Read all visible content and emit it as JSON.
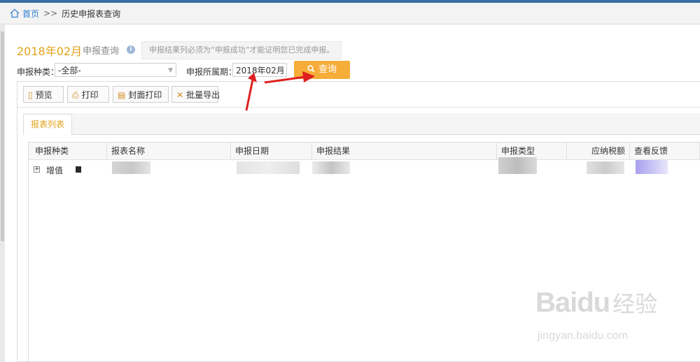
{
  "breadcrumb": {
    "home": "首页",
    "separator": ">>",
    "current": "历史申报表查询"
  },
  "header": {
    "period": "2018年02月",
    "title": "申报查询",
    "hint": "申报结果列必须为“申报成功”才能证明您已完成申报。"
  },
  "filters": {
    "type_label": "申报种类：",
    "type_value": "-全部-",
    "period_label": "申报所属期：",
    "period_value": "2018年02月",
    "query_button": "查询"
  },
  "toolbar": {
    "preview": "预览",
    "print": "打印",
    "cover_print": "封面打印",
    "batch_export": "批量导出"
  },
  "tabs": [
    "报表列表"
  ],
  "table": {
    "columns": [
      "申报种类",
      "报表名称",
      "申报日期",
      "申报结果",
      "申报类型",
      "应纳税额",
      "查看反馈"
    ],
    "rows": [
      {
        "type": "增值"
      }
    ]
  },
  "watermark": {
    "brand": "Baidu",
    "brand_cn": "经验",
    "url": "jingyan.baidu.com"
  },
  "colors": {
    "accent": "#e3a21a",
    "query_button": "#f6ad3a",
    "annotation_arrow": "#e02020",
    "link": "#2f7fcf"
  },
  "icons": [
    "home-icon",
    "info-icon",
    "search-icon",
    "preview-icon",
    "print-icon",
    "cover-print-icon",
    "export-icon",
    "expand-icon"
  ]
}
